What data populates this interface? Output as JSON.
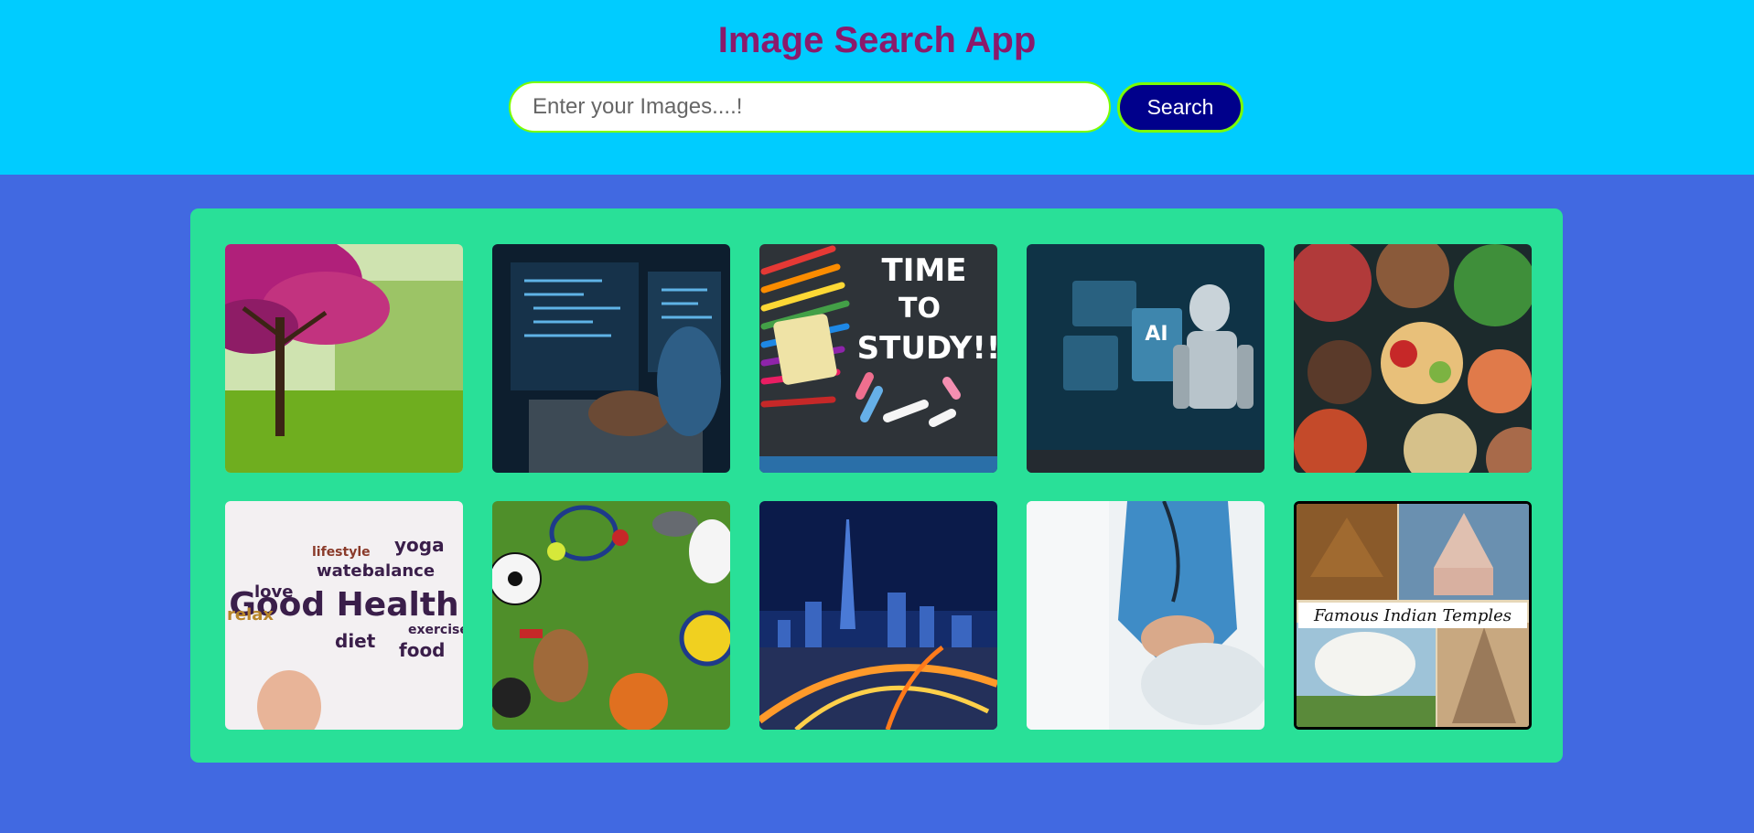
{
  "header": {
    "title": "Image Search App",
    "search": {
      "placeholder": "Enter your Images....!",
      "value": ""
    },
    "search_button_label": "Search"
  },
  "colors": {
    "header_bg": "#00ccff",
    "page_bg": "#4169e1",
    "gallery_bg": "#29e098",
    "title": "#8b1a6b",
    "button_bg": "#00008b",
    "accent_border": "#7cfc00"
  },
  "results": [
    {
      "name": "blossom-tree-park-image"
    },
    {
      "name": "coding-laptop-image"
    },
    {
      "name": "time-to-study-image",
      "caption_lines": [
        "TIME",
        "TO",
        "STUDY!!"
      ]
    },
    {
      "name": "ai-robot-image",
      "caption": "AI"
    },
    {
      "name": "food-bowls-image"
    },
    {
      "name": "good-health-word-cloud-image",
      "words": [
        "Good Health",
        "yoga",
        "balance",
        "water",
        "lifestyle",
        "exercise",
        "food",
        "diet",
        "love",
        "relax"
      ]
    },
    {
      "name": "sports-equipment-image"
    },
    {
      "name": "city-night-skyline-image"
    },
    {
      "name": "doctor-holding-hands-image"
    },
    {
      "name": "famous-indian-temples-image",
      "caption": "Famous Indian Temples"
    }
  ]
}
